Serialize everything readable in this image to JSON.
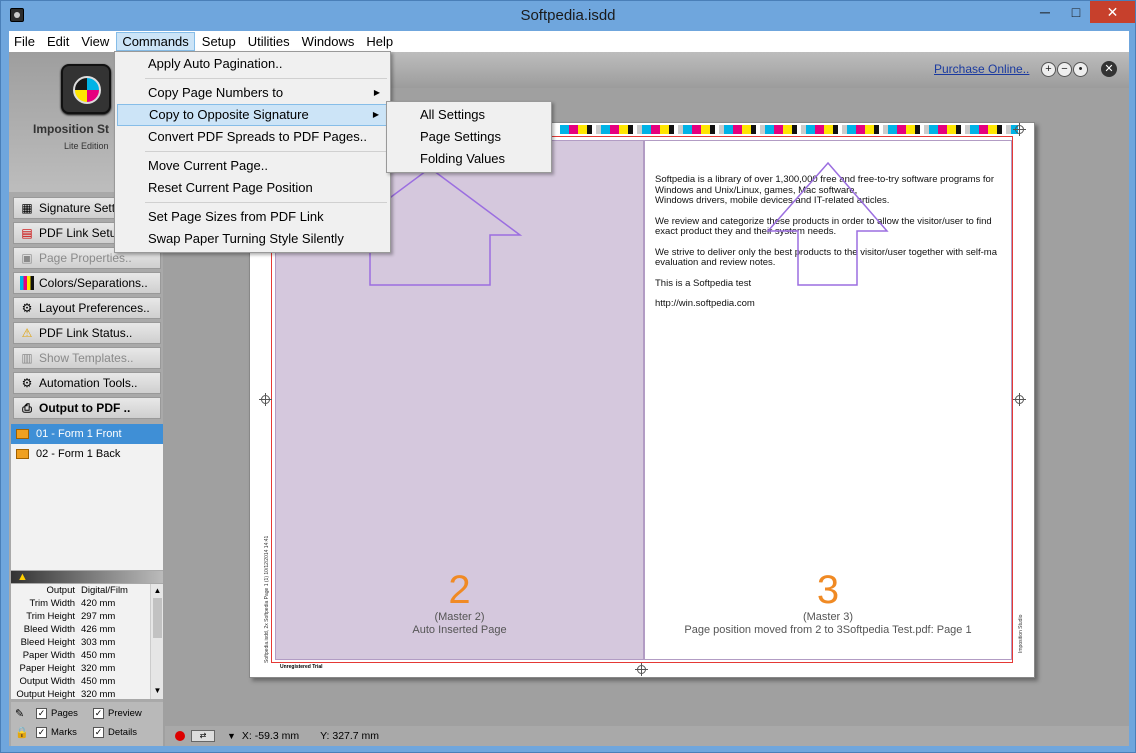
{
  "window": {
    "title": "Softpedia.isdd",
    "minimize": "─",
    "maximize": "□",
    "close": "✕"
  },
  "menubar": [
    "File",
    "Edit",
    "View",
    "Commands",
    "Setup",
    "Utilities",
    "Windows",
    "Help"
  ],
  "commands_menu": {
    "items": [
      "Apply Auto Pagination..",
      "Copy Page Numbers to",
      "Copy to Opposite Signature",
      "Convert PDF Spreads to PDF Pages..",
      "Move Current Page..",
      "Reset Current Page Position",
      "Set Page Sizes from PDF Link",
      "Swap Paper Turning Style Silently"
    ],
    "highlighted": "Copy to Opposite Signature"
  },
  "submenu": [
    "All Settings",
    "Page Settings",
    "Folding Values"
  ],
  "sidebar": {
    "logo_name": "Imposition St",
    "logo_edition": "Lite Edition",
    "buttons": [
      {
        "label": "Signature Sett",
        "icon": "grid-icon",
        "enabled": true
      },
      {
        "label": "PDF Link Setu",
        "icon": "pdf-icon",
        "enabled": true
      },
      {
        "label": "Page Properties..",
        "icon": "page-icon",
        "enabled": false
      },
      {
        "label": "Colors/Separations..",
        "icon": "cmyk-icon",
        "enabled": true
      },
      {
        "label": "Layout Preferences..",
        "icon": "gear-icon",
        "enabled": true
      },
      {
        "label": "PDF Link Status..",
        "icon": "warning-icon",
        "enabled": true
      },
      {
        "label": "Show Templates..",
        "icon": "template-icon",
        "enabled": false
      },
      {
        "label": "Automation Tools..",
        "icon": "automation-icon",
        "enabled": true
      },
      {
        "label": "Output to PDF ..",
        "icon": "printer-icon",
        "enabled": true
      }
    ],
    "forms": [
      {
        "label": "01 - Form 1 Front",
        "selected": true
      },
      {
        "label": "02 - Form 1 Back",
        "selected": false
      }
    ],
    "info": [
      {
        "key": "Output",
        "value": "Digital/Film"
      },
      {
        "key": "Trim Width",
        "value": "420 mm"
      },
      {
        "key": "Trim Height",
        "value": "297 mm"
      },
      {
        "key": "Bleed Width",
        "value": "426 mm"
      },
      {
        "key": "Bleed Height",
        "value": "303 mm"
      },
      {
        "key": "Paper Width",
        "value": "450 mm"
      },
      {
        "key": "Paper Height",
        "value": "320 mm"
      },
      {
        "key": "Output Width",
        "value": "450 mm"
      },
      {
        "key": "Output Height",
        "value": "320 mm"
      }
    ],
    "checkboxes": [
      {
        "label": "Pages",
        "checked": true
      },
      {
        "label": "Preview",
        "checked": true
      },
      {
        "label": "Marks",
        "checked": true
      },
      {
        "label": "Details",
        "checked": true
      }
    ]
  },
  "toolbar": {
    "purchase_link": "Purchase Online..",
    "zoom_in": "+",
    "zoom_out": "−",
    "zoom_fit": "•",
    "close": "✕"
  },
  "sheet": {
    "left_page": {
      "number": "2",
      "master": "(Master 2)",
      "caption": "Auto Inserted Page"
    },
    "right_page": {
      "number": "3",
      "master": "(Master 3)",
      "caption": "Page position moved from 2 to 3Softpedia Test.pdf: Page 1",
      "text": [
        "Softpedia is a library of over 1,300,000 free and free-to-try software programs for",
        " Windows and Unix/Linux, games, Mac software,",
        "Windows drivers, mobile devices and IT-related articles.",
        "We review and categorize these products in order to allow the visitor/user to find",
        " exact product they and their system needs.",
        "We strive to deliver only the best products to the visitor/user together with self-ma",
        " evaluation and review notes.",
        "This is a Softpedia test",
        "http://win.softpedia.com"
      ]
    },
    "slug_left": "Softpedia.isdd, 2x Softpedia Page 1 (1) 10/12/2014 14:41",
    "slug_unregistered": "Unregistered Trial",
    "slug_right": "Imposition Studio"
  },
  "status": {
    "x": "X: -59.3 mm",
    "y": "Y: 327.7 mm"
  },
  "colors": {
    "titlebar": "#6fa6dd",
    "accent": "#3f8fd6",
    "page_number": "#f08a24",
    "arrow": "#9b6ee0"
  }
}
